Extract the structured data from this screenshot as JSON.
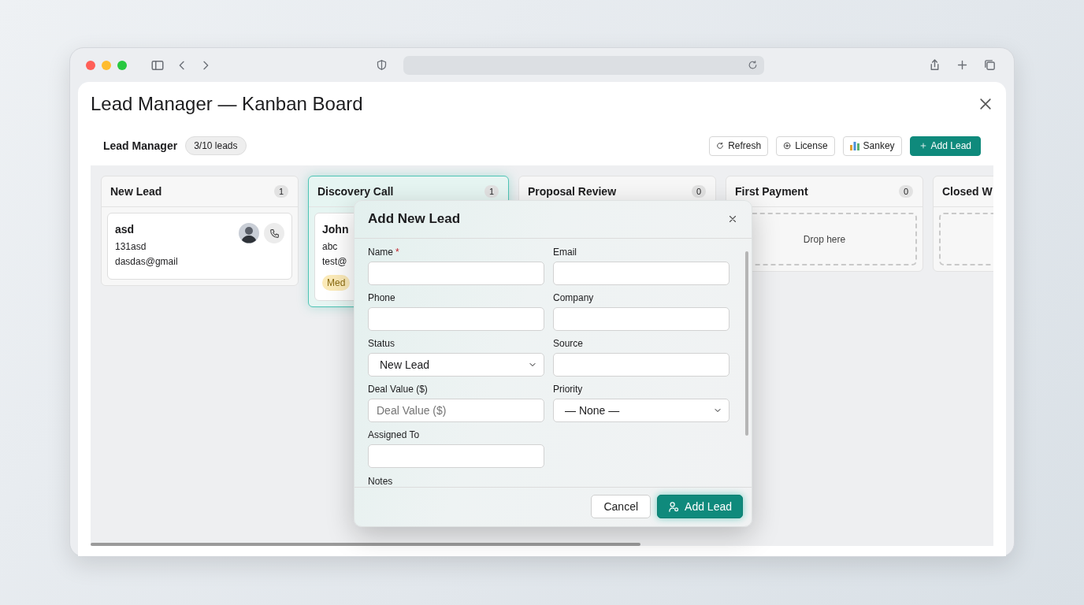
{
  "app": {
    "title": "Lead Manager — Kanban Board"
  },
  "header": {
    "title": "Lead Manager",
    "count": "3/10 leads",
    "buttons": [
      {
        "kind": "refresh",
        "label": "Refresh"
      },
      {
        "kind": "license",
        "label": "License"
      },
      {
        "kind": "sankey",
        "label": "Sankey"
      },
      {
        "kind": "add",
        "label": "Add Lead"
      }
    ]
  },
  "columns": [
    {
      "title": "New Lead",
      "count": "1",
      "highlighted": false,
      "cards": [
        {
          "name": "asd",
          "lines": [
            "131asd",
            "dasdas@gmail"
          ],
          "avatar": true,
          "call": true
        }
      ]
    },
    {
      "title": "Discovery Call",
      "count": "1",
      "highlighted": true,
      "cards": [
        {
          "name": "John",
          "lines": [
            "abc",
            "test@"
          ],
          "badge": "Med",
          "avatar": false,
          "call": false
        }
      ]
    },
    {
      "title": "Proposal Review",
      "count": "0",
      "highlighted": false
    },
    {
      "title": "First Payment",
      "count": "0",
      "highlighted": false,
      "drop_zone": true,
      "drop_text": "Drop here"
    },
    {
      "title": "Closed W",
      "highlighted": false,
      "drop_zone": true
    }
  ],
  "modal": {
    "title": "Add New Lead",
    "fields": [
      {
        "kind": "text",
        "label": "Name",
        "required_mark": "*"
      },
      {
        "kind": "text",
        "label": "Email"
      },
      {
        "kind": "text",
        "label": "Phone"
      },
      {
        "kind": "text",
        "label": "Company"
      },
      {
        "kind": "select",
        "label": "Status",
        "value": "New Lead"
      },
      {
        "kind": "text",
        "label": "Source"
      },
      {
        "kind": "text",
        "label": "Deal Value ($)",
        "placeholder": "Deal Value ($)"
      },
      {
        "kind": "select",
        "label": "Priority",
        "value": "— None —"
      },
      {
        "kind": "text",
        "label": "Assigned To"
      }
    ],
    "notes_label": "Notes",
    "buttons": [
      {
        "kind": "cancel",
        "label": "Cancel"
      },
      {
        "kind": "submit",
        "label": "Add Lead"
      }
    ]
  }
}
